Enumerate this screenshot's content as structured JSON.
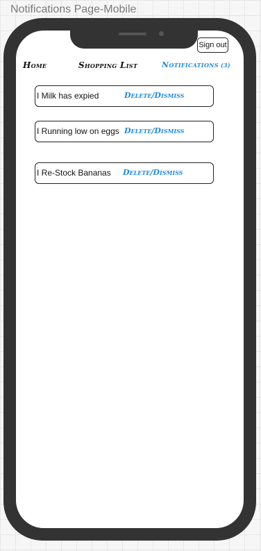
{
  "frame": {
    "title": "Notifications Page-Mobile"
  },
  "header": {
    "sign_out_label": "Sign out"
  },
  "nav": {
    "home": "Home",
    "shopping_list": "Shopping List",
    "notifications": "Notifications",
    "notifications_count": "(3)"
  },
  "notifications": [
    {
      "text": "I Milk has expied",
      "action": "Delete/Dismiss"
    },
    {
      "text": "I Running low on eggs",
      "action": "Delete/Dismiss"
    },
    {
      "text": "I Re-Stock Bananas",
      "action": "Delete/Dismiss"
    }
  ],
  "colors": {
    "phone_body": "#333333",
    "link_blue": "#1f8be0",
    "screen": "#ffffff"
  }
}
